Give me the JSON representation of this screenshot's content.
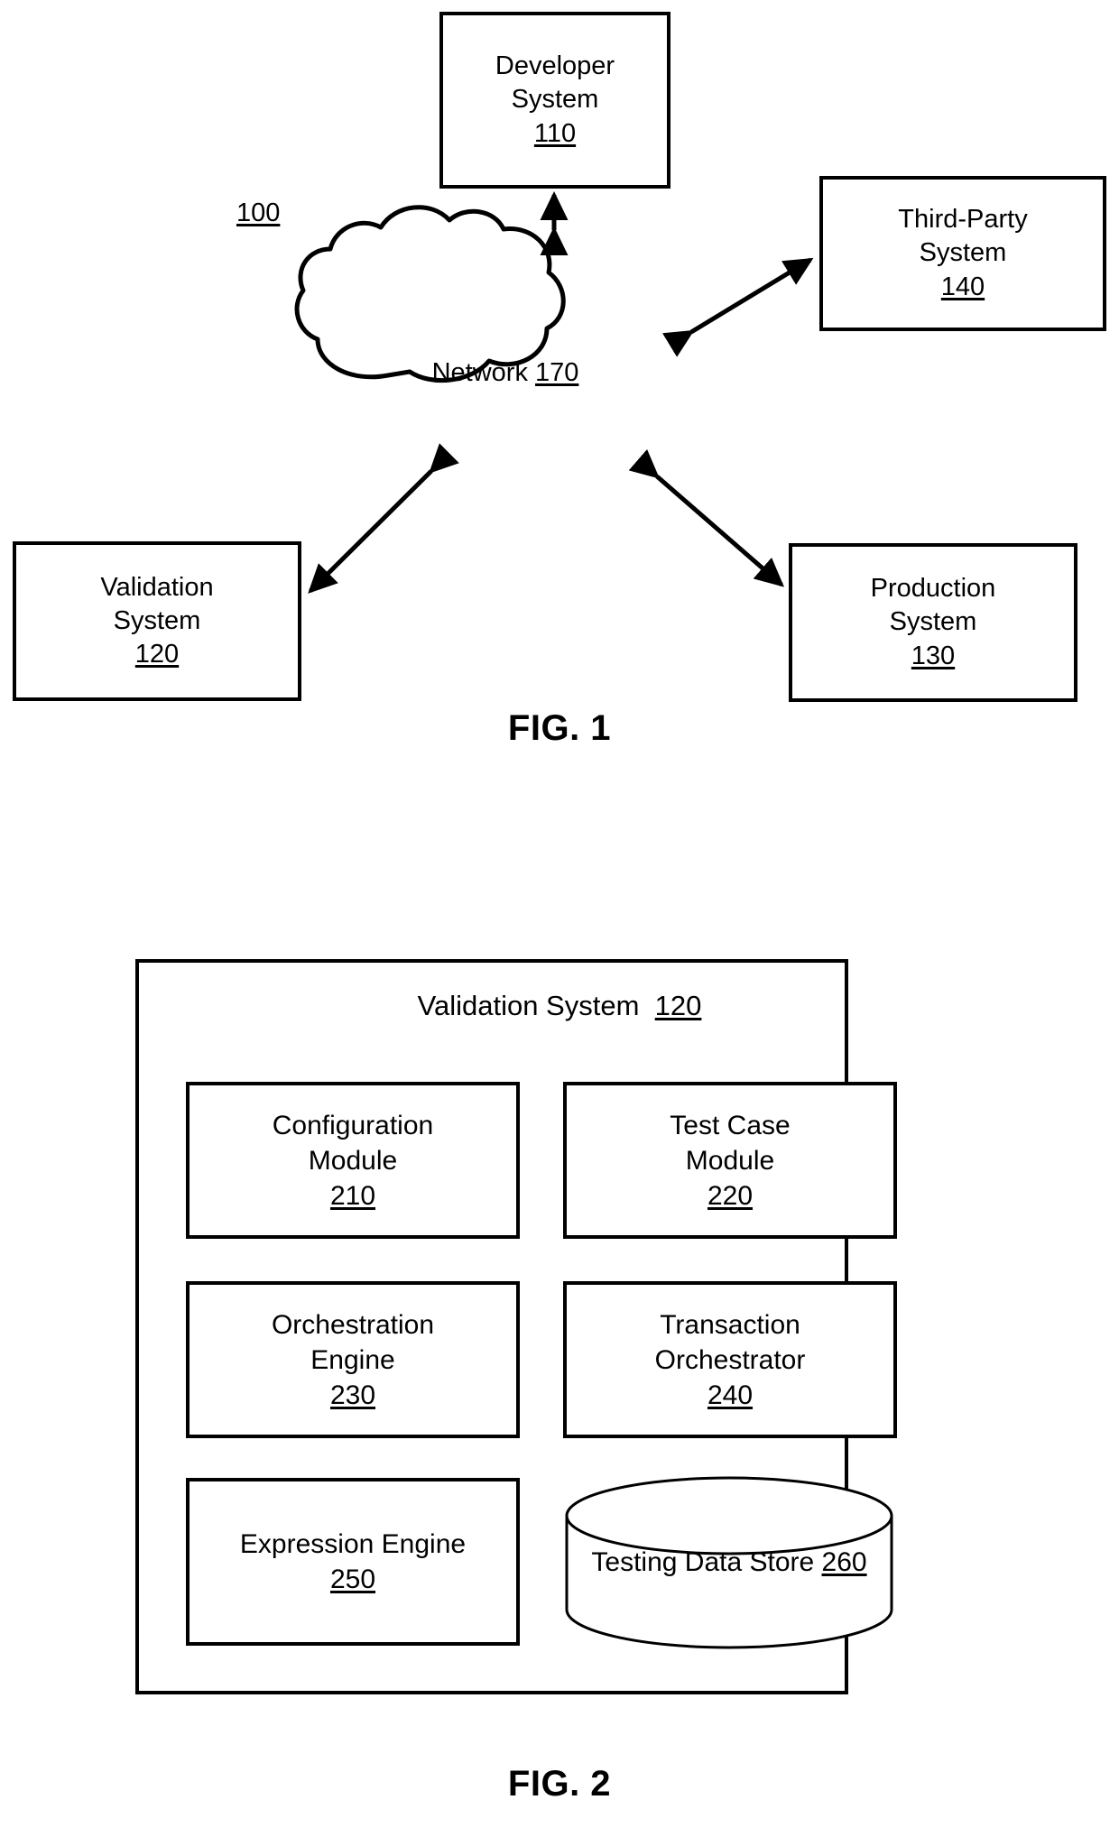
{
  "figure1": {
    "caption": "FIG. 1",
    "system_ref": "100",
    "nodes": [
      {
        "id": "developer-system",
        "title_lines": [
          "Developer",
          "System"
        ],
        "ref": "110"
      },
      {
        "id": "third-party-system",
        "title_lines": [
          "Third-Party",
          "System"
        ],
        "ref": "140"
      },
      {
        "id": "validation-system",
        "title_lines": [
          "Validation",
          "System"
        ],
        "ref": "120"
      },
      {
        "id": "production-system",
        "title_lines": [
          "Production",
          "System"
        ],
        "ref": "130"
      }
    ],
    "cloud": {
      "label": "Network",
      "ref": "170"
    },
    "connections": [
      {
        "from": "network-cloud",
        "to": "developer-system",
        "arrows": "both"
      },
      {
        "from": "network-cloud",
        "to": "third-party-system",
        "arrows": "both"
      },
      {
        "from": "network-cloud",
        "to": "validation-system",
        "arrows": "both"
      },
      {
        "from": "network-cloud",
        "to": "production-system",
        "arrows": "both"
      }
    ]
  },
  "figure2": {
    "caption": "FIG. 2",
    "container_title": "Validation System",
    "container_ref": "120",
    "modules": [
      {
        "id": "configuration-module",
        "title_lines": [
          "Configuration",
          "Module"
        ],
        "ref": "210",
        "shape": "box"
      },
      {
        "id": "test-case-module",
        "title_lines": [
          "Test Case",
          "Module"
        ],
        "ref": "220",
        "shape": "box"
      },
      {
        "id": "orchestration-engine",
        "title_lines": [
          "Orchestration",
          "Engine"
        ],
        "ref": "230",
        "shape": "box"
      },
      {
        "id": "transaction-orchestrator",
        "title_lines": [
          "Transaction",
          "Orchestrator"
        ],
        "ref": "240",
        "shape": "box"
      },
      {
        "id": "expression-engine",
        "title_lines": [
          "Expression Engine"
        ],
        "ref": "250",
        "shape": "box"
      },
      {
        "id": "testing-data-store",
        "title_lines": [
          "Testing Data Store"
        ],
        "ref": "260",
        "shape": "cylinder"
      }
    ]
  },
  "style": {
    "ink": "#000000",
    "paper": "#ffffff"
  }
}
